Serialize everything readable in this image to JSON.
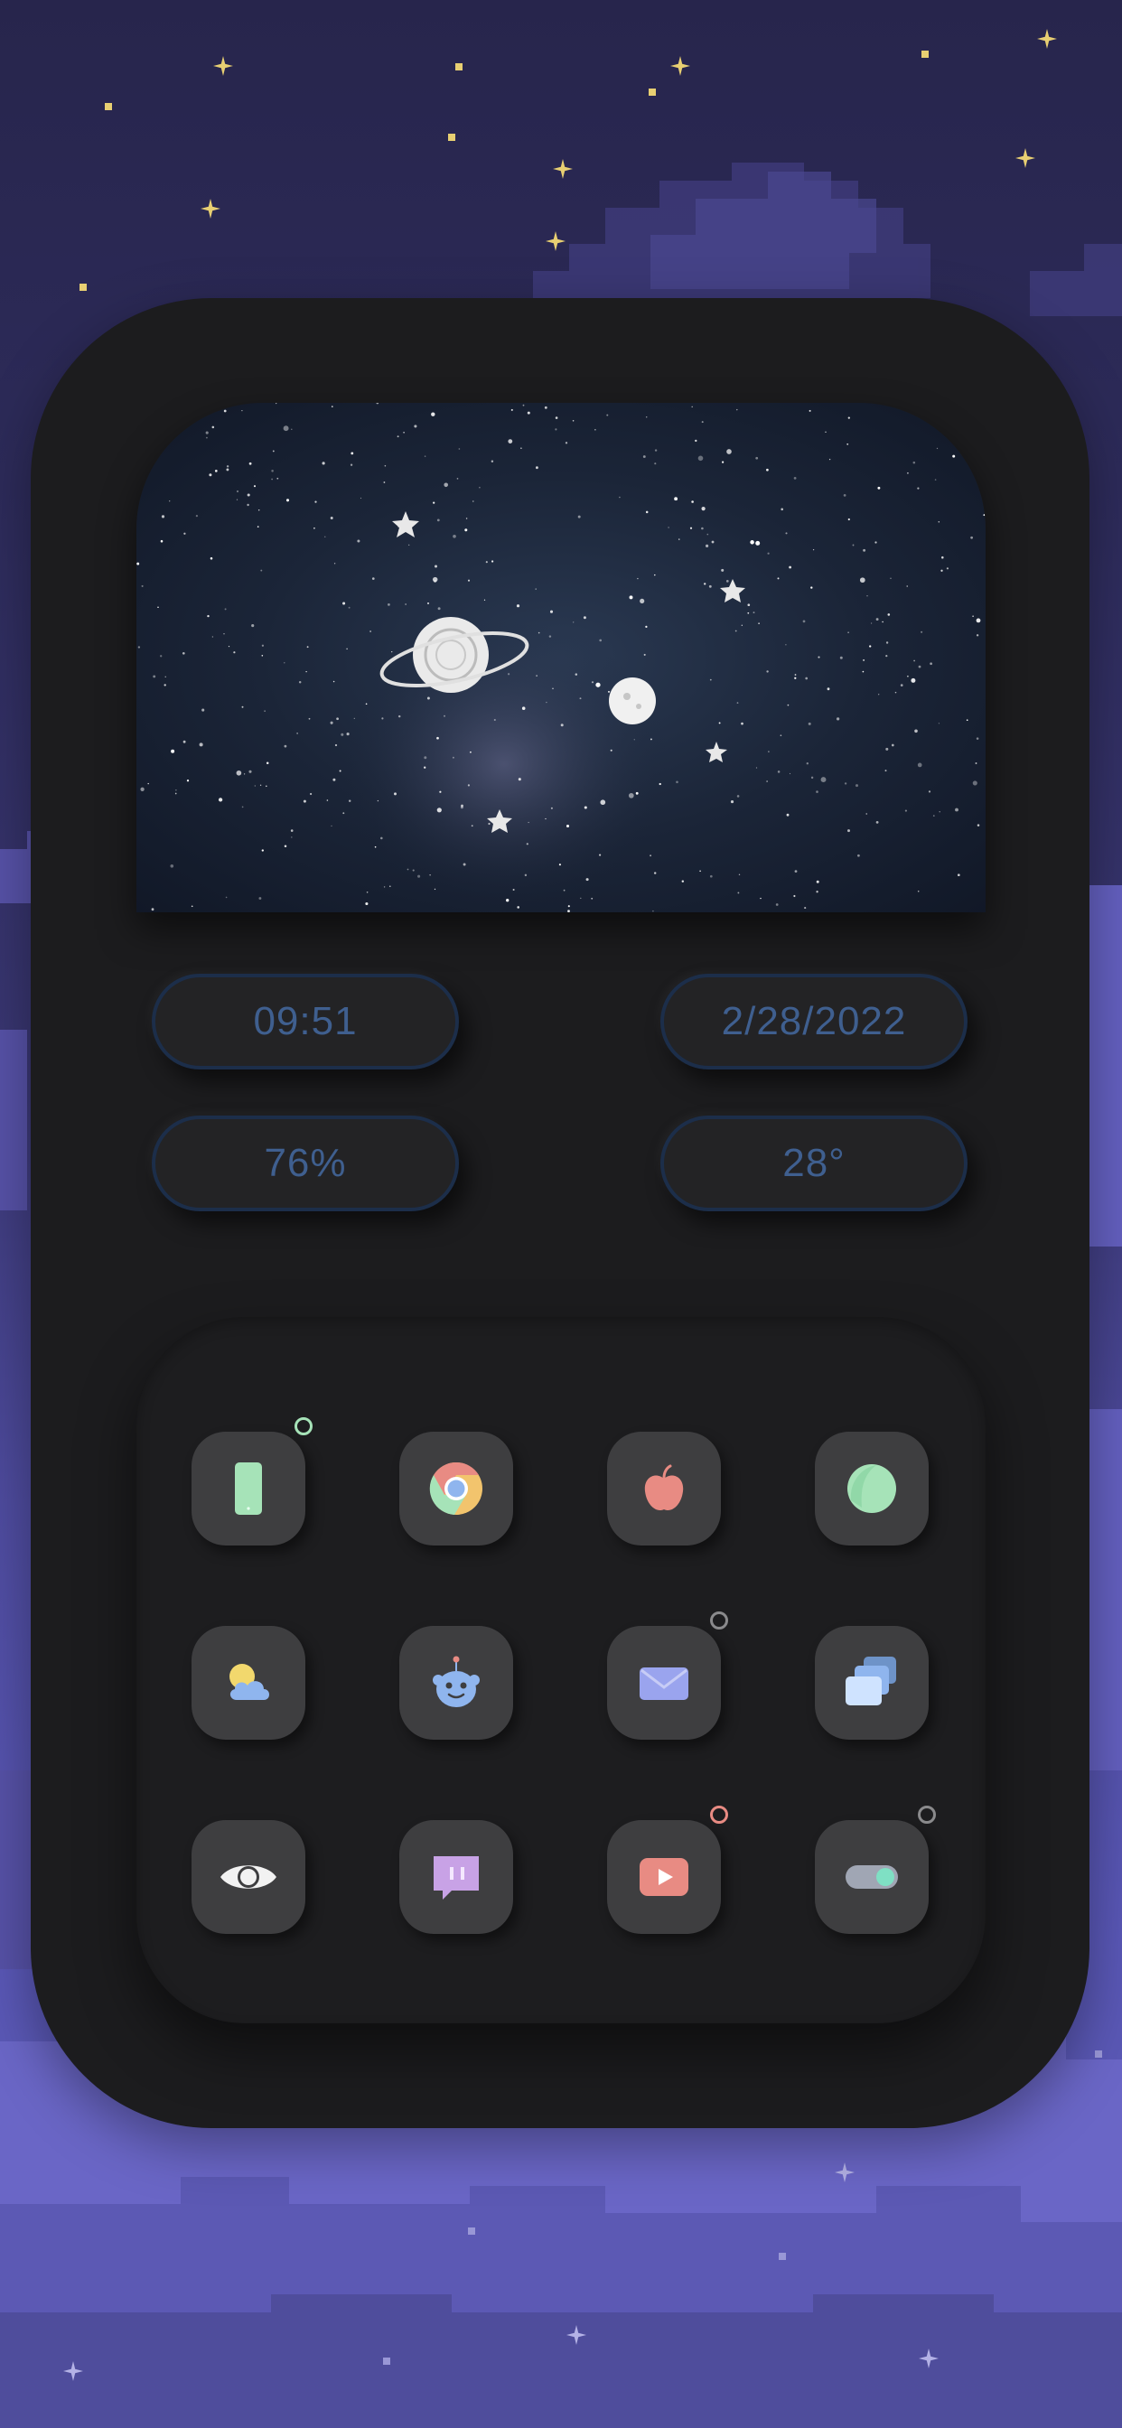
{
  "widgets": {
    "time": "09:51",
    "date": "2/28/2022",
    "battery": "76%",
    "temperature": "28°"
  },
  "apps": [
    {
      "name": "phone-icon",
      "badge": "#a6e3b8"
    },
    {
      "name": "chrome-icon"
    },
    {
      "name": "apple-icon"
    },
    {
      "name": "circle-app-icon"
    },
    {
      "name": "weather-icon"
    },
    {
      "name": "reddit-icon"
    },
    {
      "name": "mail-icon",
      "badge": "#8a8a8c"
    },
    {
      "name": "cards-icon"
    },
    {
      "name": "eye-icon"
    },
    {
      "name": "chat-icon"
    },
    {
      "name": "youtube-icon",
      "badge": "#e88b83"
    },
    {
      "name": "toggle-icon",
      "badge": "#8a8a8c"
    }
  ],
  "colors": {
    "pill_text": "#3f5f8f",
    "device_bg": "#1c1c1e",
    "app_tile": "#3e3e40"
  }
}
